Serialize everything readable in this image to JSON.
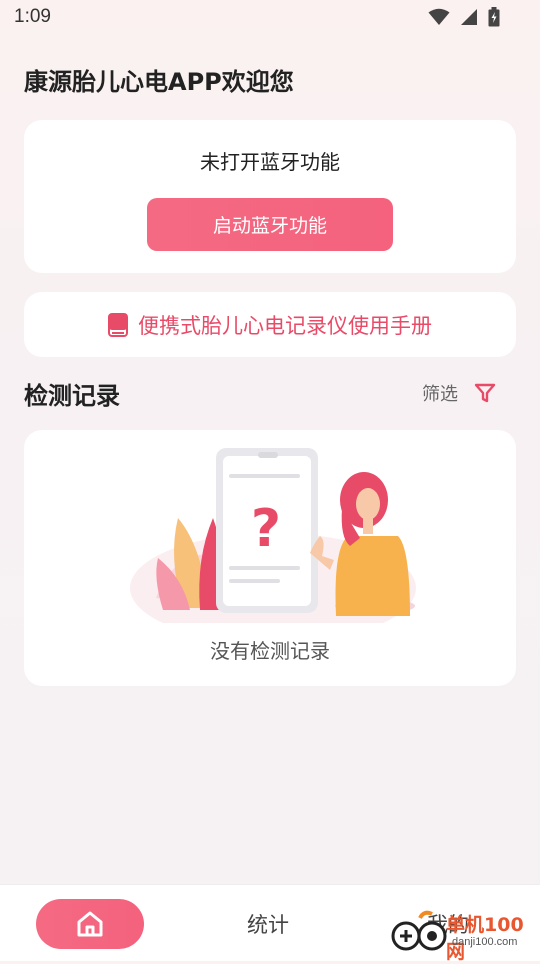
{
  "status_bar": {
    "time": "1:09",
    "icons": [
      "wifi-icon",
      "cellular-signal-icon",
      "battery-charging-icon"
    ]
  },
  "header": {
    "title": "康源胎儿心电APP欢迎您"
  },
  "bluetooth_card": {
    "status_text": "未打开蓝牙功能",
    "button_label": "启动蓝牙功能"
  },
  "manual": {
    "icon": "book-icon",
    "label": "便携式胎儿心电记录仪使用手册"
  },
  "records": {
    "title": "检测记录",
    "filter_label": "筛选",
    "filter_icon": "filter-icon",
    "empty_text": "没有检测记录"
  },
  "bottom_nav": {
    "home_icon": "home-icon",
    "stats_label": "统计",
    "mine_label": "我的"
  },
  "watermark": {
    "line1": "单机100网",
    "line2": "danji100.com"
  },
  "colors": {
    "accent": "#f4627d",
    "accent_text": "#e84b68",
    "background": "#f7f1f3",
    "card": "#ffffff"
  }
}
